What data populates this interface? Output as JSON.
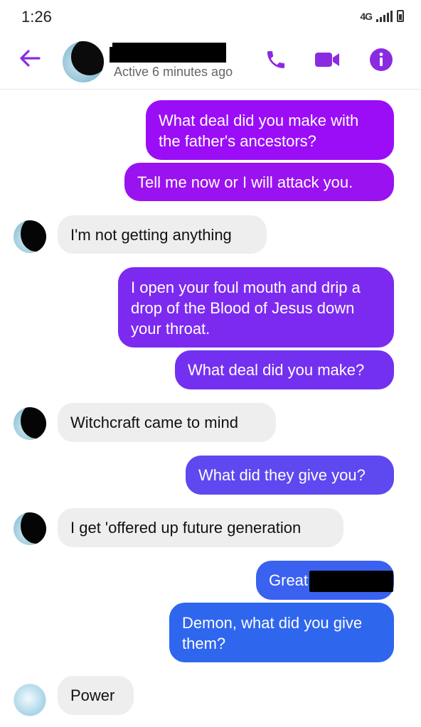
{
  "status_bar": {
    "time": "1:26",
    "network": "4G"
  },
  "header": {
    "active_status": "Active 6 minutes ago",
    "accent_color": "#8a2be2"
  },
  "messages": [
    {
      "sender": "me",
      "text": "What deal did you make with the father's ancestors?",
      "color": "#9b0df7"
    },
    {
      "sender": "me",
      "text": "Tell me now or I will attack you.",
      "color": "#9a12f0"
    },
    {
      "sender": "them",
      "text": "I'm not getting anything"
    },
    {
      "sender": "me",
      "text": "I open your foul mouth and drip a drop of the Blood of Jesus down your throat.",
      "color": "#7c2af0"
    },
    {
      "sender": "me",
      "text": "What deal did you make?",
      "color": "#7430f0"
    },
    {
      "sender": "them",
      "text": "Witchcraft came to mind"
    },
    {
      "sender": "me",
      "text": "What did they give you?",
      "color": "#5e48ef"
    },
    {
      "sender": "them",
      "text": "I get 'offered up future generation"
    },
    {
      "sender": "me",
      "text": "Great",
      "color": "#3a61ef"
    },
    {
      "sender": "me",
      "text": "Demon, what did you give them?",
      "color": "#2f66ee"
    },
    {
      "sender": "them",
      "text": "Power"
    }
  ]
}
